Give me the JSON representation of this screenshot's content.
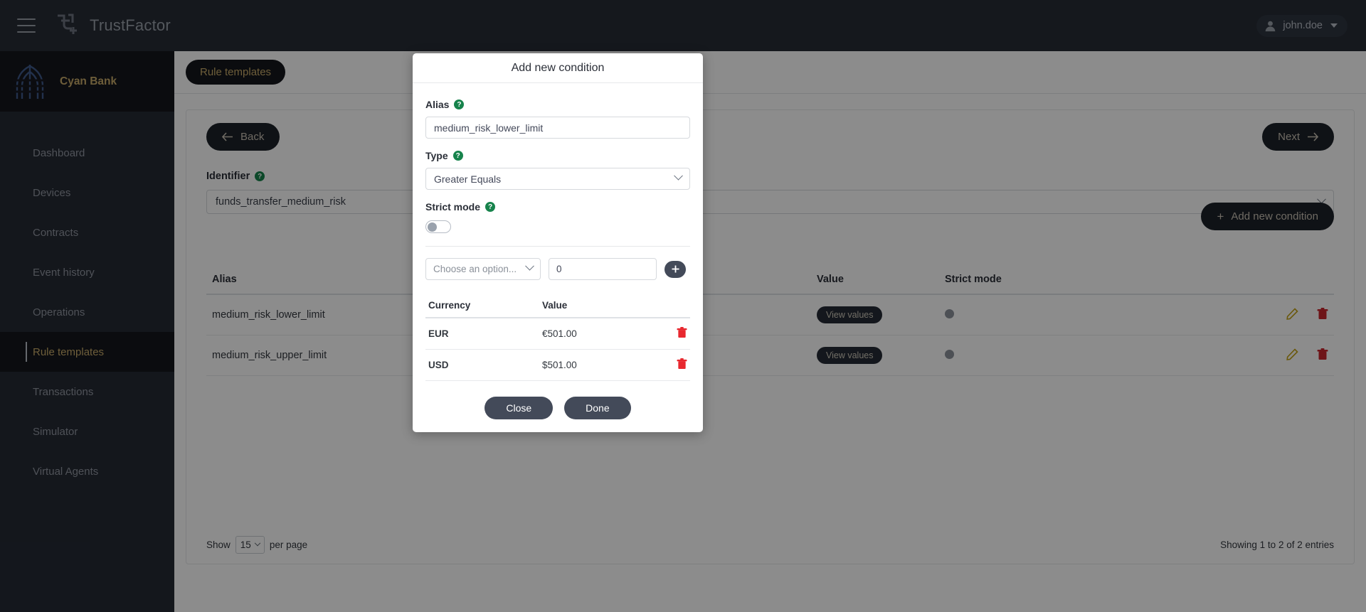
{
  "topbar": {
    "menu_icon": "hamburger-icon",
    "brand": "TrustFactor",
    "user": "john.doe",
    "user_icon": "user-icon",
    "caret_icon": "chevron-down-icon"
  },
  "sidebar": {
    "tenant": "Cyan Bank",
    "items": [
      {
        "label": "Dashboard",
        "active": false
      },
      {
        "label": "Devices",
        "active": false
      },
      {
        "label": "Contracts",
        "active": false
      },
      {
        "label": "Event history",
        "active": false
      },
      {
        "label": "Operations",
        "active": false
      },
      {
        "label": "Rule templates",
        "active": true
      },
      {
        "label": "Transactions",
        "active": false
      },
      {
        "label": "Simulator",
        "active": false
      },
      {
        "label": "Virtual Agents",
        "active": false
      }
    ]
  },
  "breadcrumb": {
    "label": "Rule templates"
  },
  "page": {
    "back_label": "Back",
    "back_icon": "arrow-left-icon",
    "next_label": "Next",
    "next_icon": "arrow-right-icon",
    "identifier_label": "Identifier",
    "identifier_value": "funds_transfer_medium_risk",
    "help_icon": "help-circle-icon",
    "add_condition_label": "Add new condition",
    "add_condition_icon": "plus-icon"
  },
  "conditions_table": {
    "columns": [
      "Alias",
      "Value",
      "Strict mode",
      ""
    ],
    "rows": [
      {
        "alias": "medium_risk_lower_limit",
        "value_label": "View values",
        "strict_mode": "off",
        "edit_icon": "pencil-icon",
        "delete_icon": "trash-icon"
      },
      {
        "alias": "medium_risk_upper_limit",
        "value_label": "View values",
        "strict_mode": "off",
        "edit_icon": "pencil-icon",
        "delete_icon": "trash-icon"
      }
    ],
    "footer": {
      "show_label": "Show",
      "per_page_value": "15",
      "per_page_label": "per page",
      "entries_info": "Showing 1 to 2 of 2 entries"
    }
  },
  "modal": {
    "title": "Add new condition",
    "alias_label": "Alias",
    "alias_value": "medium_risk_lower_limit",
    "type_label": "Type",
    "type_value": "Greater Equals",
    "strict_mode_label": "Strict mode",
    "strict_mode_state": "off",
    "help_icon": "help-circle-icon",
    "option_placeholder": "Choose an option...",
    "option_value": "0",
    "add_icon": "plus-icon",
    "currency_table": {
      "columns": [
        "Currency",
        "Value",
        ""
      ],
      "rows": [
        {
          "currency": "EUR",
          "value": "€501.00",
          "delete_icon": "trash-icon"
        },
        {
          "currency": "USD",
          "value": "$501.00",
          "delete_icon": "trash-icon"
        }
      ]
    },
    "close_label": "Close",
    "done_label": "Done"
  },
  "colors": {
    "topbar_bg": "#272c36",
    "sidebar_bg": "#252a34",
    "sidebar_active_bg": "#14171d",
    "accent_gold": "#c9ab6a",
    "help_green": "#17834c",
    "danger_red": "#c9252d",
    "edit_yellow": "#c2a014",
    "button_dark": "#434a59"
  }
}
